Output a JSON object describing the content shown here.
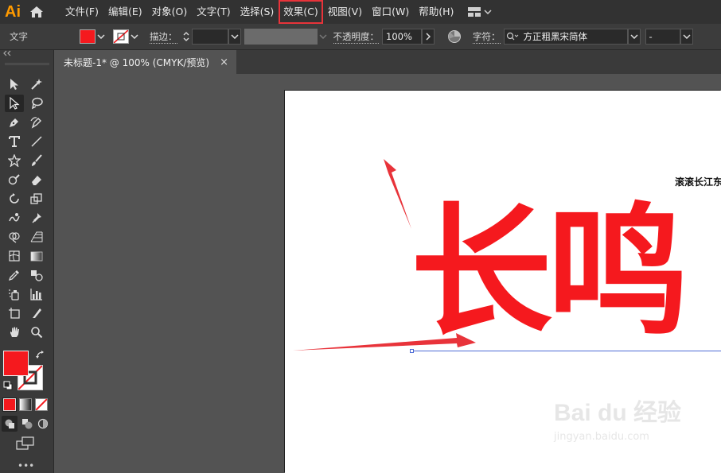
{
  "app": {
    "logo": "Ai",
    "menu": [
      {
        "label": "文件(F)"
      },
      {
        "label": "编辑(E)"
      },
      {
        "label": "对象(O)"
      },
      {
        "label": "文字(T)"
      },
      {
        "label": "选择(S)"
      },
      {
        "label": "效果(C)",
        "highlighted": true
      },
      {
        "label": "视图(V)"
      },
      {
        "label": "窗口(W)"
      },
      {
        "label": "帮助(H)"
      }
    ]
  },
  "control_bar": {
    "mode_label": "文字",
    "fill_color": "#f5191e",
    "stroke_label": "描边：",
    "opacity_label": "不透明度：",
    "opacity_value": "100%",
    "char_label": "字符：",
    "font_name": "方正粗黑宋简体",
    "font_style": "-"
  },
  "document": {
    "tab_title": "未标题-1* @ 100% (CMYK/预览)",
    "close_glyph": "×"
  },
  "artboard": {
    "main_text": "长鸣",
    "main_text_color": "#f5191e",
    "small_text": "滚滚长江东",
    "baseline_color": "#4d6bd6"
  },
  "watermark": {
    "brand": "Bai du 经验",
    "url": "jingyan.baidu.com"
  },
  "annotation": {
    "highlight_color": "#e8333a",
    "arrow_color": "#e8333a"
  }
}
